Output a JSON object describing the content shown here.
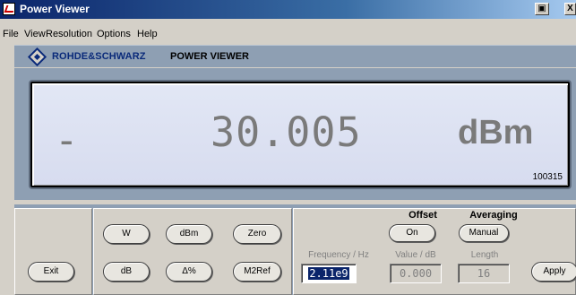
{
  "window": {
    "title": "Power Viewer",
    "buttons": [
      "▣",
      "X"
    ]
  },
  "menu": [
    "File",
    "View",
    "Resolution",
    "Options",
    "Help"
  ],
  "brand": {
    "company": "ROHDE&SCHWARZ",
    "product": "POWER VIEWER"
  },
  "display": {
    "sign": "-",
    "value": "30.005",
    "unit": "dBm",
    "serial": "100315"
  },
  "buttons": {
    "exit": "Exit",
    "w": "W",
    "dbm": "dBm",
    "zero": "Zero",
    "db": "dB",
    "delta_pct": "Δ%",
    "m2ref": "M2Ref",
    "offset_on": "On",
    "averaging_manual": "Manual",
    "apply": "Apply"
  },
  "headers": {
    "offset": "Offset",
    "averaging": "Averaging"
  },
  "fields": {
    "frequency": {
      "label": "Frequency / Hz",
      "value": "2.11e9"
    },
    "offset_value": {
      "label": "Value / dB",
      "value": "0.000"
    },
    "length": {
      "label": "Length",
      "value": "16"
    }
  }
}
